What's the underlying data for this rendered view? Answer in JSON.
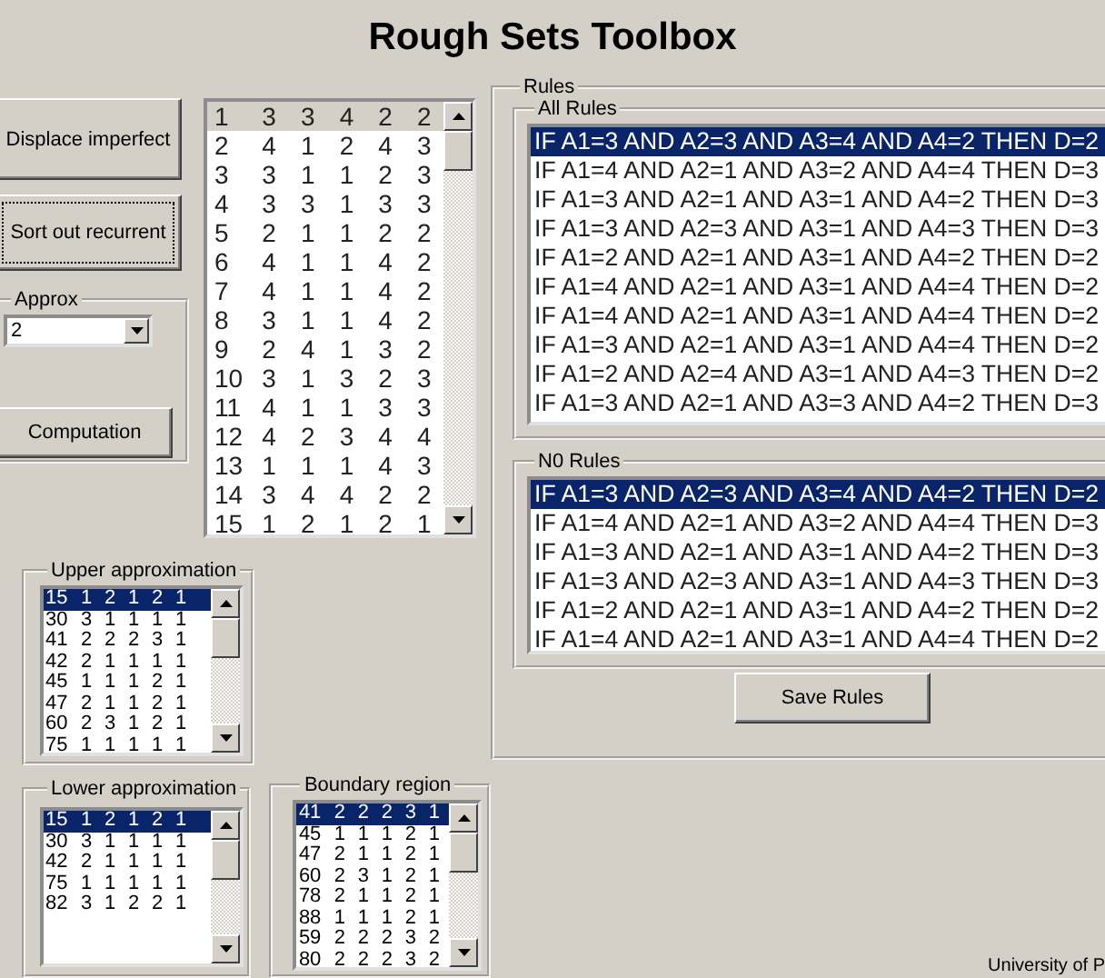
{
  "title": "Rough Sets Toolbox",
  "buttons": [
    {
      "label": "Displace imperfect",
      "focused": false
    },
    {
      "label": "Sort out recurrent",
      "focused": true
    }
  ],
  "approx": {
    "label": "Approx",
    "value": "2"
  },
  "computation_button": {
    "label": "Computation",
    "focused": false
  },
  "data_list": {
    "active": false,
    "rows": [
      {
        "cells": [
          "1",
          "3",
          "3",
          "4",
          "2",
          "2"
        ],
        "selected": true
      },
      {
        "cells": [
          "2",
          "4",
          "1",
          "2",
          "4",
          "3"
        ],
        "selected": false
      },
      {
        "cells": [
          "3",
          "3",
          "1",
          "1",
          "2",
          "3"
        ],
        "selected": false
      },
      {
        "cells": [
          "4",
          "3",
          "3",
          "1",
          "3",
          "3"
        ],
        "selected": false
      },
      {
        "cells": [
          "5",
          "2",
          "1",
          "1",
          "2",
          "2"
        ],
        "selected": false
      },
      {
        "cells": [
          "6",
          "4",
          "1",
          "1",
          "4",
          "2"
        ],
        "selected": false
      },
      {
        "cells": [
          "7",
          "4",
          "1",
          "1",
          "4",
          "2"
        ],
        "selected": false
      },
      {
        "cells": [
          "8",
          "3",
          "1",
          "1",
          "4",
          "2"
        ],
        "selected": false
      },
      {
        "cells": [
          "9",
          "2",
          "4",
          "1",
          "3",
          "2"
        ],
        "selected": false
      },
      {
        "cells": [
          "10",
          "3",
          "1",
          "3",
          "2",
          "3"
        ],
        "selected": false
      },
      {
        "cells": [
          "11",
          "4",
          "1",
          "1",
          "3",
          "3"
        ],
        "selected": false
      },
      {
        "cells": [
          "12",
          "4",
          "2",
          "3",
          "4",
          "4"
        ],
        "selected": false
      },
      {
        "cells": [
          "13",
          "1",
          "1",
          "1",
          "4",
          "3"
        ],
        "selected": false
      },
      {
        "cells": [
          "14",
          "3",
          "4",
          "4",
          "2",
          "2"
        ],
        "selected": false
      },
      {
        "cells": [
          "15",
          "1",
          "2",
          "1",
          "2",
          "1"
        ],
        "selected": false
      }
    ]
  },
  "upper_approximation": {
    "label": "Upper approximation",
    "active": true,
    "rows": [
      {
        "cells": [
          "15",
          "1",
          "2",
          "1",
          "2",
          "1"
        ],
        "selected": true
      },
      {
        "cells": [
          "30",
          "3",
          "1",
          "1",
          "1",
          "1"
        ],
        "selected": false
      },
      {
        "cells": [
          "41",
          "2",
          "2",
          "2",
          "3",
          "1"
        ],
        "selected": false
      },
      {
        "cells": [
          "42",
          "2",
          "1",
          "1",
          "1",
          "1"
        ],
        "selected": false
      },
      {
        "cells": [
          "45",
          "1",
          "1",
          "1",
          "2",
          "1"
        ],
        "selected": false
      },
      {
        "cells": [
          "47",
          "2",
          "1",
          "1",
          "2",
          "1"
        ],
        "selected": false
      },
      {
        "cells": [
          "60",
          "2",
          "3",
          "1",
          "2",
          "1"
        ],
        "selected": false
      },
      {
        "cells": [
          "75",
          "1",
          "1",
          "1",
          "1",
          "1"
        ],
        "selected": false
      }
    ]
  },
  "lower_approximation": {
    "label": "Lower approximation",
    "active": true,
    "rows": [
      {
        "cells": [
          "15",
          "1",
          "2",
          "1",
          "2",
          "1"
        ],
        "selected": true
      },
      {
        "cells": [
          "30",
          "3",
          "1",
          "1",
          "1",
          "1"
        ],
        "selected": false
      },
      {
        "cells": [
          "42",
          "2",
          "1",
          "1",
          "1",
          "1"
        ],
        "selected": false
      },
      {
        "cells": [
          "75",
          "1",
          "1",
          "1",
          "1",
          "1"
        ],
        "selected": false
      },
      {
        "cells": [
          "82",
          "3",
          "1",
          "2",
          "2",
          "1"
        ],
        "selected": false
      }
    ]
  },
  "boundary_region": {
    "label": "Boundary region",
    "active": true,
    "rows": [
      {
        "cells": [
          "41",
          "2",
          "2",
          "2",
          "3",
          "1"
        ],
        "selected": true
      },
      {
        "cells": [
          "45",
          "1",
          "1",
          "1",
          "2",
          "1"
        ],
        "selected": false
      },
      {
        "cells": [
          "47",
          "2",
          "1",
          "1",
          "2",
          "1"
        ],
        "selected": false
      },
      {
        "cells": [
          "60",
          "2",
          "3",
          "1",
          "2",
          "1"
        ],
        "selected": false
      },
      {
        "cells": [
          "78",
          "2",
          "1",
          "1",
          "2",
          "1"
        ],
        "selected": false
      },
      {
        "cells": [
          "88",
          "1",
          "1",
          "1",
          "2",
          "1"
        ],
        "selected": false
      },
      {
        "cells": [
          "59",
          "2",
          "2",
          "2",
          "3",
          "2"
        ],
        "selected": false
      },
      {
        "cells": [
          "80",
          "2",
          "2",
          "2",
          "3",
          "2"
        ],
        "selected": false
      }
    ]
  },
  "rules": {
    "label": "Rules",
    "all_rules": {
      "label": "All Rules",
      "active": true,
      "rows": [
        {
          "text": "IF A1=3 AND A2=3 AND A3=4 AND A4=2 THEN D=2",
          "selected": true
        },
        {
          "text": "IF A1=4 AND A2=1 AND A3=2 AND A4=4 THEN D=3",
          "selected": false
        },
        {
          "text": "IF A1=3 AND A2=1 AND A3=1 AND A4=2 THEN D=3",
          "selected": false
        },
        {
          "text": "IF A1=3 AND A2=3 AND A3=1 AND A4=3 THEN D=3",
          "selected": false
        },
        {
          "text": "IF A1=2 AND A2=1 AND A3=1 AND A4=2 THEN D=2",
          "selected": false
        },
        {
          "text": "IF A1=4 AND A2=1 AND A3=1 AND A4=4 THEN D=2",
          "selected": false
        },
        {
          "text": "IF A1=4 AND A2=1 AND A3=1 AND A4=4 THEN D=2",
          "selected": false
        },
        {
          "text": "IF A1=3 AND A2=1 AND A3=1 AND A4=4 THEN D=2",
          "selected": false
        },
        {
          "text": "IF A1=2 AND A2=4 AND A3=1 AND A4=3 THEN D=2",
          "selected": false
        },
        {
          "text": "IF A1=3 AND A2=1 AND A3=3 AND A4=2 THEN D=3",
          "selected": false
        }
      ]
    },
    "n0_rules": {
      "label": "N0 Rules",
      "active": true,
      "rows": [
        {
          "text": "IF A1=3 AND A2=3 AND A3=4 AND A4=2 THEN D=2",
          "selected": true
        },
        {
          "text": "IF A1=4 AND A2=1 AND A3=2 AND A4=4 THEN D=3",
          "selected": false
        },
        {
          "text": "IF A1=3 AND A2=1 AND A3=1 AND A4=2 THEN D=3",
          "selected": false
        },
        {
          "text": "IF A1=3 AND A2=3 AND A3=1 AND A4=3 THEN D=3",
          "selected": false
        },
        {
          "text": "IF A1=2 AND A2=1 AND A3=1 AND A4=2 THEN D=2",
          "selected": false
        },
        {
          "text": "IF A1=4 AND A2=1 AND A3=1 AND A4=4 THEN D=2",
          "selected": false
        }
      ]
    },
    "save_button": {
      "label": "Save Rules",
      "focused": false
    }
  },
  "footer": "University of P"
}
